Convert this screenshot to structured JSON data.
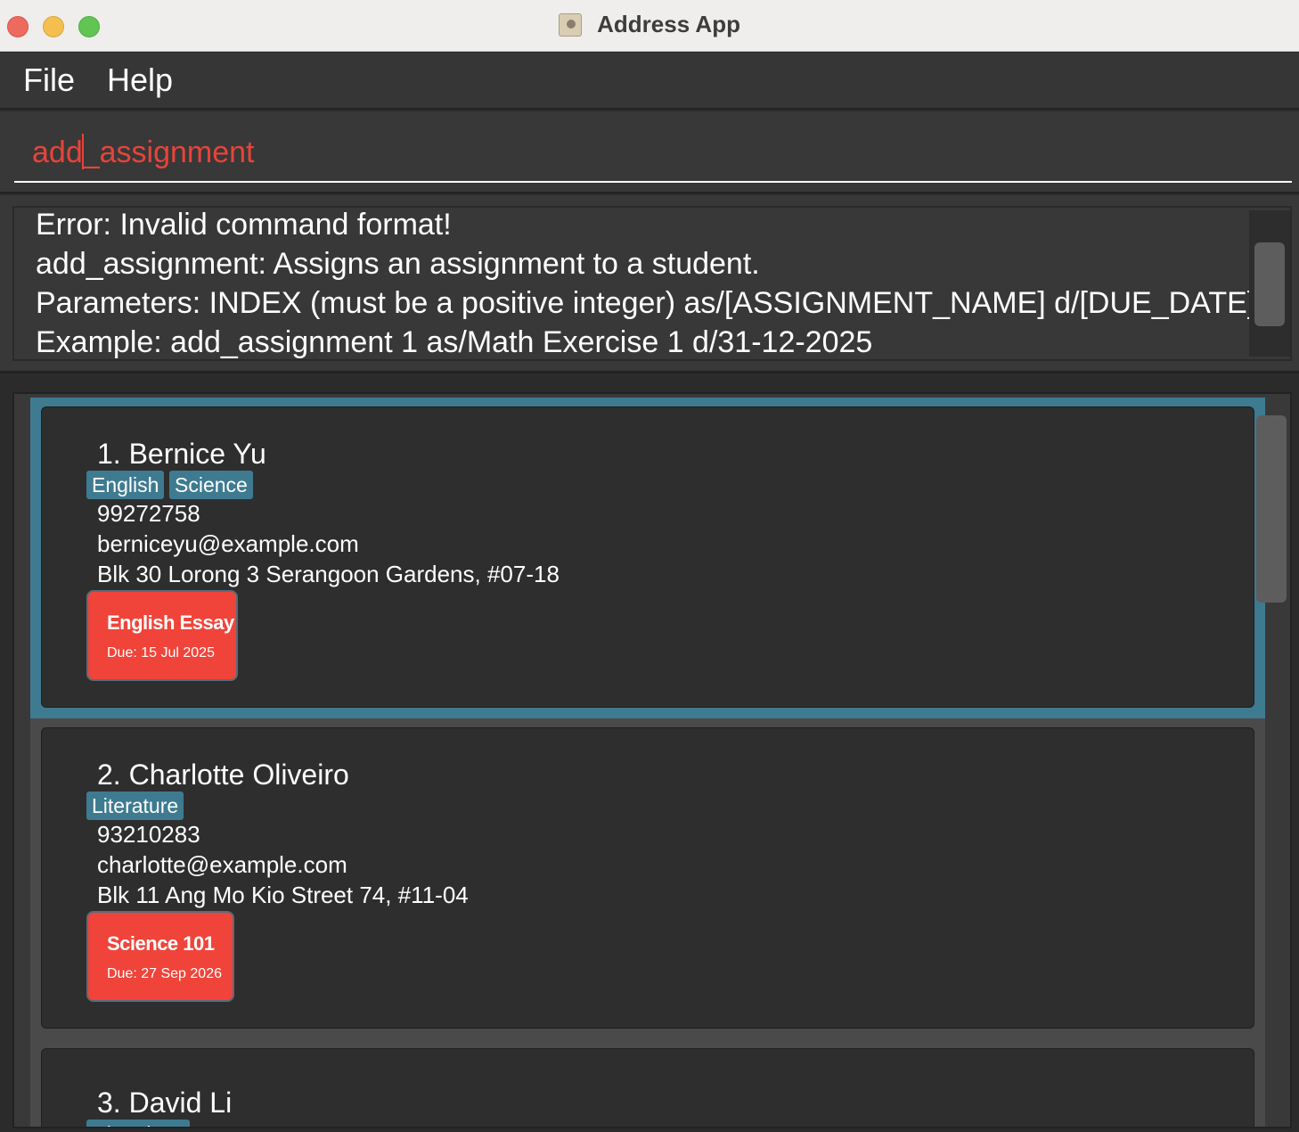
{
  "window": {
    "title": "Address App"
  },
  "menu": {
    "file": "File",
    "help": "Help"
  },
  "command": {
    "value": "add_assignment"
  },
  "result": {
    "lines": [
      "Error: Invalid command format!",
      "add_assignment: Assigns an assignment to a student.",
      "Parameters: INDEX (must be a positive integer) as/[ASSIGNMENT_NAME] d/[DUE_DATE]",
      "Example: add_assignment 1 as/Math Exercise 1 d/31-12-2025"
    ]
  },
  "persons": [
    {
      "name": "1. Bernice Yu",
      "tags": [
        "English",
        "Science"
      ],
      "phone": "99272758",
      "email": "berniceyu@example.com",
      "address": "Blk 30 Lorong 3 Serangoon Gardens, #07-18",
      "assignment": {
        "name": "English Essay",
        "due": "Due: 15 Jul 2025"
      }
    },
    {
      "name": "2. Charlotte Oliveiro",
      "tags": [
        "Literature"
      ],
      "phone": "93210283",
      "email": "charlotte@example.com",
      "address": "Blk 11 Ang Mo Kio Street 74, #11-04",
      "assignment": {
        "name": "Science 101",
        "due": "Due: 27 Sep 2026"
      }
    },
    {
      "name": "3. David Li",
      "tags": [
        "Chemistry"
      ]
    }
  ],
  "colors": {
    "accent": "#3e7b91",
    "assignment_overdue": "#f0443a",
    "command_error_text": "#e8443a",
    "background": "#2b2b2b"
  },
  "icons": {
    "app": "address-book-icon"
  }
}
